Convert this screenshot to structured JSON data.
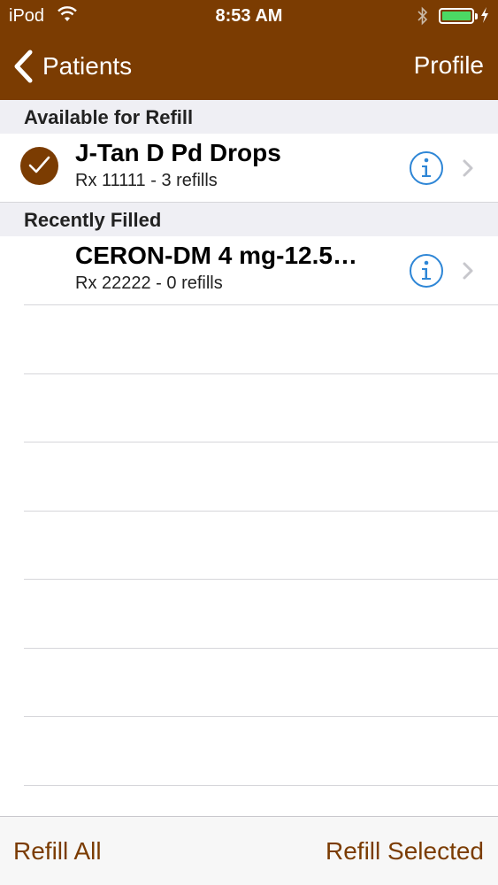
{
  "status_bar": {
    "carrier": "iPod",
    "time": "8:53 AM",
    "battery_color": "#4cd964"
  },
  "nav_bar": {
    "back_label": "Patients",
    "right_label": "Profile",
    "background": "#7b3c02"
  },
  "sections": [
    {
      "header": "Available for Refill",
      "rows": [
        {
          "title": "J-Tan D Pd Drops",
          "subtitle": "Rx 11111 - 3 refills",
          "selected": true
        }
      ]
    },
    {
      "header": "Recently Filled",
      "rows": [
        {
          "title": "CERON-DM 4 mg-12.5…",
          "subtitle": "Rx 22222 - 0 refills",
          "selected": false
        }
      ]
    }
  ],
  "toolbar": {
    "left_label": "Refill All",
    "right_label": "Refill Selected",
    "tint": "#7b3c02"
  },
  "icons": {
    "back": "chevron-left-icon",
    "check": "checkmark-circle-icon",
    "info": "info-icon",
    "disclosure": "chevron-right-icon"
  }
}
